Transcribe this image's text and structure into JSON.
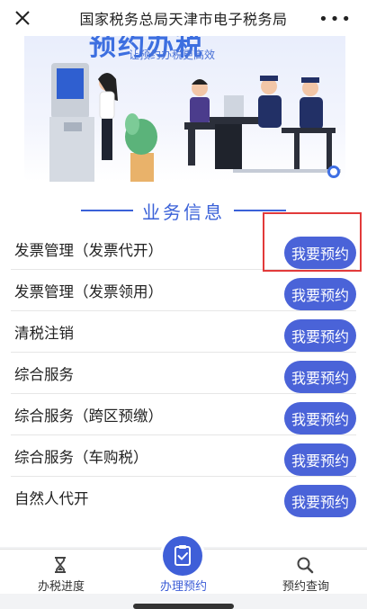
{
  "header": {
    "title": "国家税务总局天津市电子税务局",
    "more": "•••"
  },
  "banner": {
    "title": "预约办税",
    "subtitle": "让预约办税更高效"
  },
  "section": {
    "title": "业务信息"
  },
  "services": [
    {
      "label": "发票管理（发票代开）",
      "button": "我要预约"
    },
    {
      "label": "发票管理（发票领用）",
      "button": "我要预约"
    },
    {
      "label": "清税注销",
      "button": "我要预约"
    },
    {
      "label": "综合服务",
      "button": "我要预约"
    },
    {
      "label": "综合服务（跨区预缴）",
      "button": "我要预约"
    },
    {
      "label": "综合服务（车购税）",
      "button": "我要预约"
    },
    {
      "label": "自然人代开",
      "button": "我要预约"
    }
  ],
  "nav": {
    "tabs": [
      {
        "label": "办税进度",
        "icon": "hourglass-icon"
      },
      {
        "label": "办理预约",
        "icon": "clipboard-check-icon"
      },
      {
        "label": "预约查询",
        "icon": "search-icon"
      }
    ],
    "active_index": 1
  },
  "colors": {
    "accent": "#4a63d8",
    "highlight": "#e23a3a",
    "section_title": "#3a61d8"
  }
}
